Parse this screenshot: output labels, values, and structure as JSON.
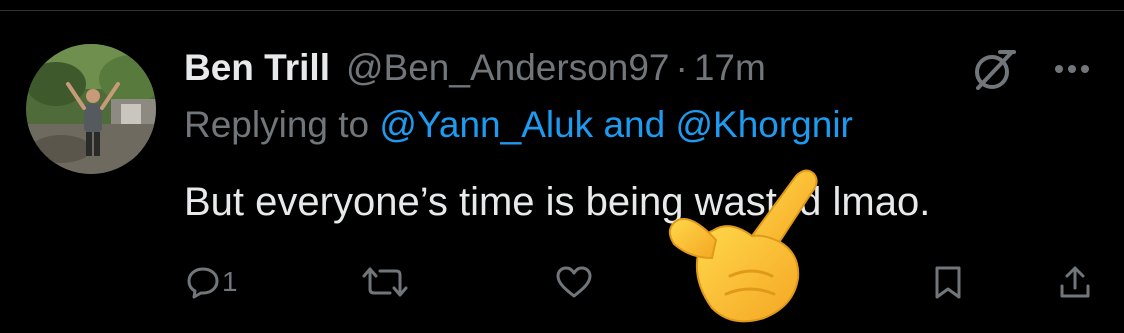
{
  "tweet": {
    "display_name": "Ben Trill",
    "handle": "@Ben_Anderson97",
    "separator": "·",
    "time": "17m",
    "replying_prefix": "Replying to",
    "mention_1": "@Yann_Aluk",
    "mention_joiner": "and",
    "mention_2": "@Khorgnir",
    "text": "But everyone’s time is being wasted lmao."
  },
  "actions": {
    "reply_count": "1"
  },
  "icons": {
    "grok": "grok-icon",
    "more": "more-icon",
    "reply": "reply-icon",
    "retweet": "retweet-icon",
    "like": "heart-icon",
    "bookmark": "bookmark-icon",
    "share": "share-icon"
  },
  "colors": {
    "background": "#000000",
    "text_primary": "#e7e9ea",
    "text_secondary": "#71767b",
    "link": "#1d9bf0"
  }
}
